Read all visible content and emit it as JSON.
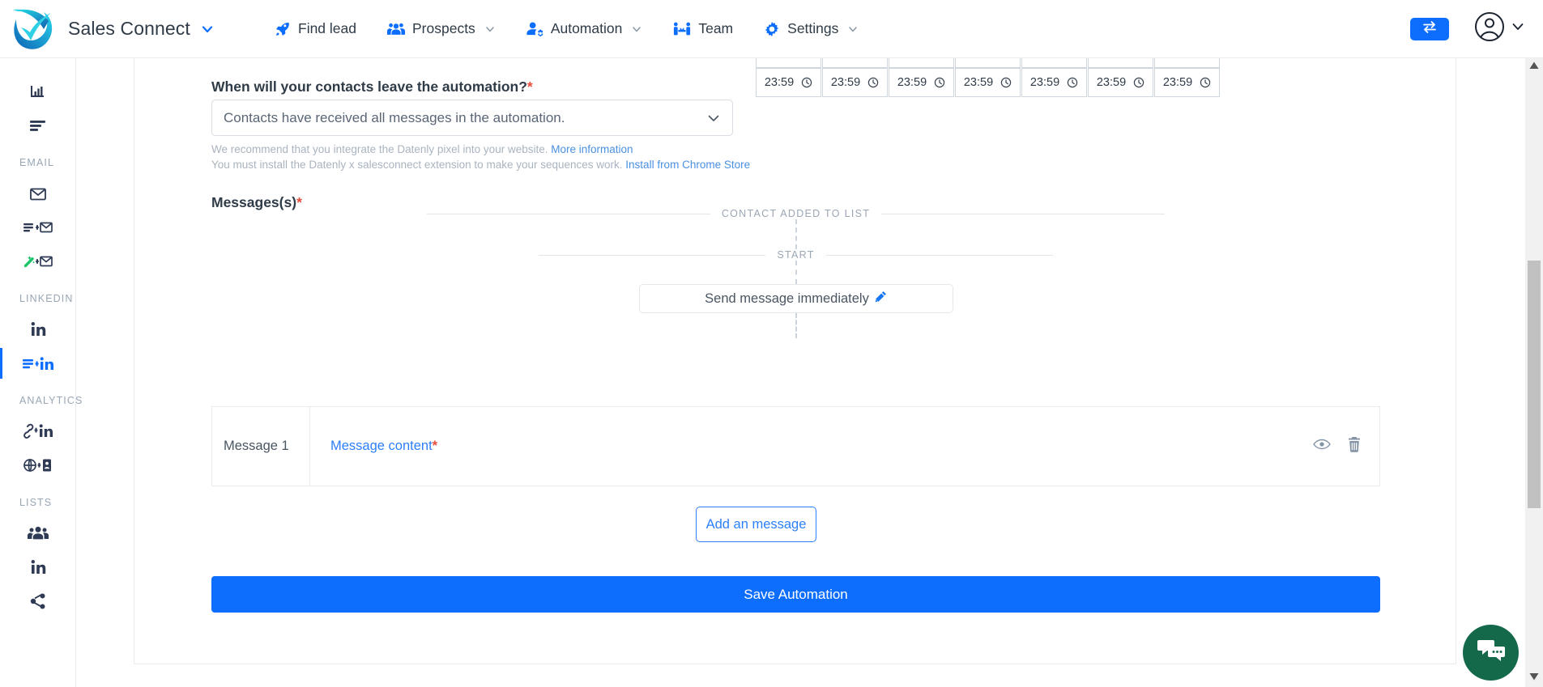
{
  "header": {
    "brand": "Sales Connect",
    "logo_icon": "sales-connect-logo",
    "brand_caret_icon": "chevron-down-icon",
    "nav": [
      {
        "label": "Find lead",
        "icon": "rocket-icon",
        "caret": false
      },
      {
        "label": "Prospects",
        "icon": "people-group-icon",
        "caret": true
      },
      {
        "label": "Automation",
        "icon": "user-gear-icon",
        "caret": true
      },
      {
        "label": "Team",
        "icon": "handshake-icon",
        "caret": false
      },
      {
        "label": "Settings",
        "icon": "gear-icon",
        "caret": true
      }
    ],
    "swap_icon": "swap-arrows-icon",
    "avatar_icon": "user-circle-icon",
    "avatar_caret_icon": "chevron-down-icon",
    "accent": "#0d6efd"
  },
  "sidebar": {
    "groups": [
      {
        "label": "",
        "items": [
          {
            "icon": "analytics-bars-icon",
            "active": false
          },
          {
            "icon": "list-lines-icon",
            "active": false
          }
        ]
      },
      {
        "label": "EMAIL",
        "items": [
          {
            "icon": "envelope-icon",
            "active": false
          },
          {
            "icon": "list-plus-envelope-icon",
            "active": false
          },
          {
            "icon": "magic-wand-envelope-icon",
            "active": false
          }
        ]
      },
      {
        "label": "LINKEDIN",
        "items": [
          {
            "icon": "linkedin-in-icon",
            "active": false
          },
          {
            "icon": "list-plus-linkedin-icon",
            "active": true
          }
        ]
      },
      {
        "label": "ANALYTICS",
        "items": [
          {
            "icon": "link-plus-linkedin-icon",
            "active": false
          },
          {
            "icon": "globe-plus-card-icon",
            "active": false
          }
        ]
      },
      {
        "label": "LISTS",
        "items": [
          {
            "icon": "people-group-icon",
            "active": false
          },
          {
            "icon": "linkedin-in-icon",
            "active": false
          },
          {
            "icon": "share-nodes-icon",
            "active": false
          }
        ]
      }
    ]
  },
  "main": {
    "question": {
      "label": "When will your contacts leave the automation?",
      "required_mark": "*",
      "selected_option": "Contacts have received all messages in the automation.",
      "caret_icon": "chevron-down-icon"
    },
    "hints": [
      {
        "text": "We recommend that you integrate the Datenly pixel into your website.",
        "link": "More information"
      },
      {
        "text": "You must install the Datenly x salesconnect extension to make your sequences work.",
        "link": "Install from Chrome Store"
      }
    ],
    "time_inputs": {
      "clock_icon": "clock-icon",
      "partial_row_count": 7,
      "values": [
        "23:59",
        "23:59",
        "23:59",
        "23:59",
        "23:59",
        "23:59",
        "23:59"
      ]
    },
    "messages_section": {
      "title": "Messages(s)",
      "required_mark": "*",
      "flow": {
        "contact_added": "CONTACT ADDED TO LIST",
        "start": "START",
        "immediate_label": "Send message immediately",
        "edit_icon": "pencil-icon"
      },
      "message_rows": [
        {
          "name": "Message 1",
          "content_link": "Message content",
          "required_mark": "*",
          "preview_icon": "eye-icon",
          "delete_icon": "trash-icon"
        }
      ],
      "add_button": "Add an message",
      "save_button": "Save Automation"
    }
  },
  "chat": {
    "icon": "chat-bubbles-icon",
    "color": "#15694b"
  },
  "scrollbar": {
    "up_icon": "scroll-up-arrow-icon",
    "down_icon": "scroll-down-arrow-icon",
    "thumb": "vertical-scroll-thumb"
  }
}
